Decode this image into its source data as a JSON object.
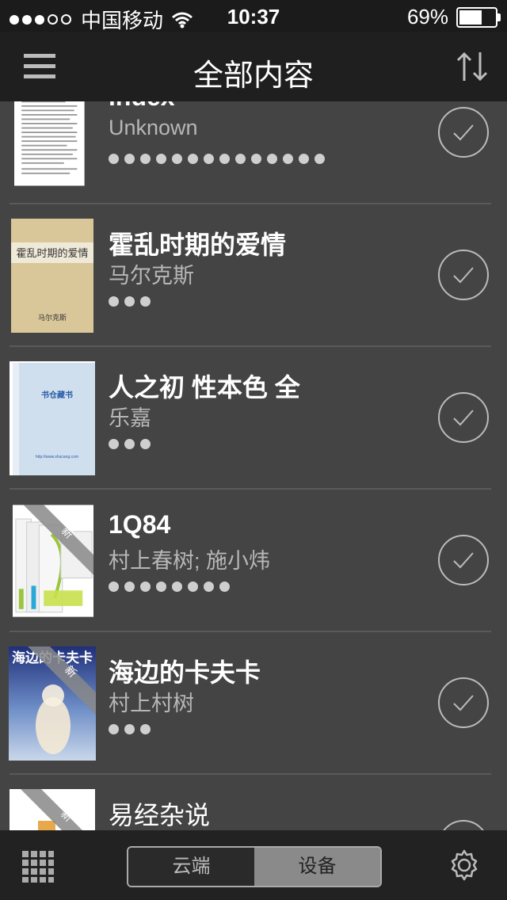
{
  "status": {
    "carrier": "中国移动",
    "time": "10:37",
    "battery": "69%",
    "battery_level": 0.69
  },
  "nav": {
    "title": "全部内容"
  },
  "items": [
    {
      "title": "index",
      "author": "Unknown",
      "dots": 14,
      "badge": ""
    },
    {
      "title": "霍乱时期的爱情",
      "author": "马尔克斯",
      "dots": 3,
      "cover_title": "霍乱时期的爱情",
      "cover_author": "马尔克斯"
    },
    {
      "title": "人之初 性本色 全",
      "author": "乐嘉",
      "dots": 3,
      "cover_title": "书仓藏书",
      "cover_url": "http://www.shucang.com"
    },
    {
      "title": "1Q84",
      "author": "村上春树; 施小炜",
      "dots": 8,
      "badge": "新"
    },
    {
      "title": "海边的卡夫卡",
      "author": "村上村树",
      "dots": 3,
      "badge": "新",
      "cover_title": "海边的卡夫卡"
    },
    {
      "title": "易经杂说",
      "author": "",
      "dots": 0,
      "badge": "新"
    }
  ],
  "tabbar": {
    "cloud": "云端",
    "device": "设备"
  }
}
